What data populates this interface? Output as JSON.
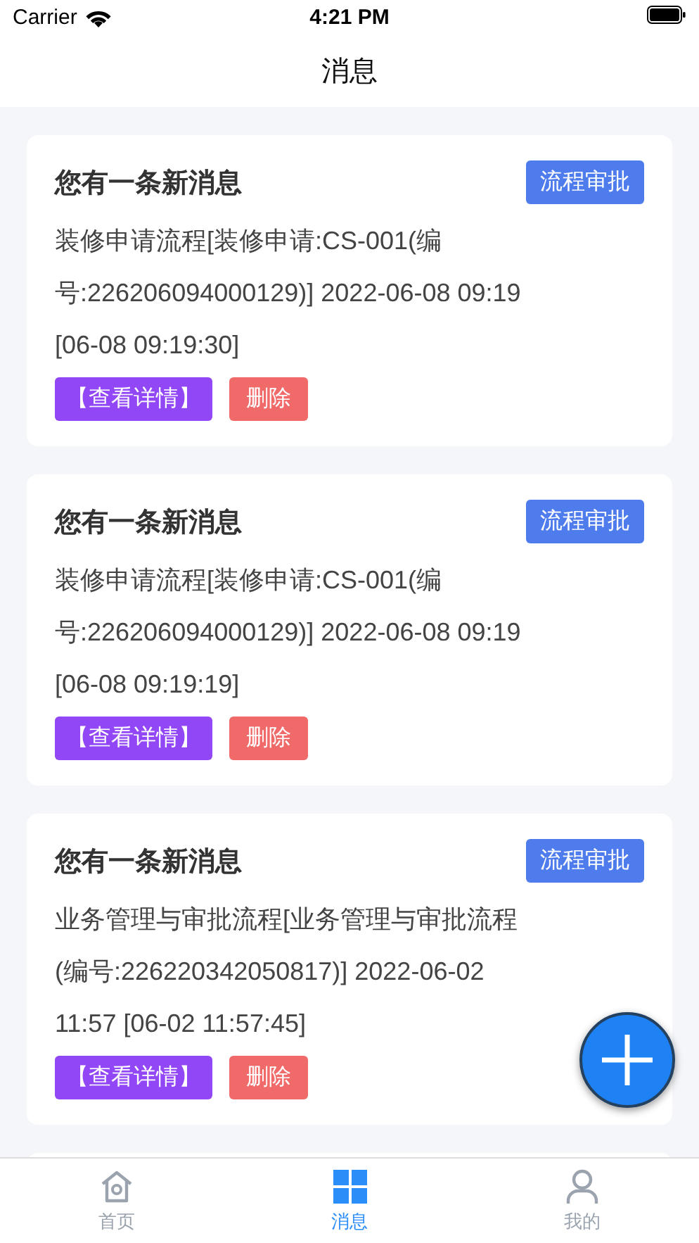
{
  "status_bar": {
    "carrier": "Carrier",
    "time": "4:21 PM"
  },
  "nav": {
    "title": "消息"
  },
  "messages": [
    {
      "title": "您有一条新消息",
      "tag": "流程审批",
      "body": "装修申请流程[装修申请:CS-001(编号:226206094000129)] 2022-06-08 09:19 [06-08 09:19:30]",
      "detail_button": "【查看详情】",
      "delete_button": "删除"
    },
    {
      "title": "您有一条新消息",
      "tag": "流程审批",
      "body": "装修申请流程[装修申请:CS-001(编号:226206094000129)] 2022-06-08 09:19 [06-08 09:19:19]",
      "detail_button": "【查看详情】",
      "delete_button": "删除"
    },
    {
      "title": "您有一条新消息",
      "tag": "流程审批",
      "body": "业务管理与审批流程[业务管理与审批流程(编号:226220342050817)] 2022-06-02 11:57 [06-02 11:57:45]",
      "detail_button": "【查看详情】",
      "delete_button": "删除"
    }
  ],
  "tabs": [
    {
      "label": "首页",
      "selected": false
    },
    {
      "label": "消息",
      "selected": true
    },
    {
      "label": "我的",
      "selected": false
    }
  ]
}
